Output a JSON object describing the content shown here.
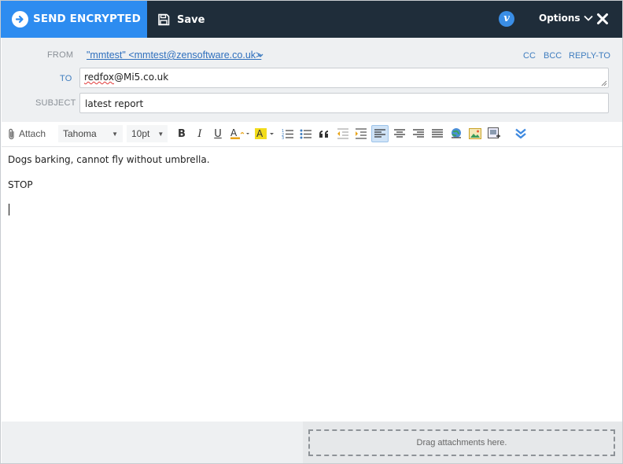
{
  "topbar": {
    "send_label": "SEND ENCRYPTED",
    "save_label": "Save",
    "brand_badge": "v",
    "options_label": "Options",
    "colors": {
      "bar_bg": "#1f2d3a",
      "send_bg": "#2d8cf0",
      "badge_bg": "#3a8ee6"
    }
  },
  "header": {
    "from_label": "FROM",
    "from_value": "\"mmtest\" <mmtest@zensoftware.co.uk>",
    "to_label": "TO",
    "to_value_name": "redfox",
    "to_value_domain": "@Mi5.co.uk",
    "subject_label": "SUBJECT",
    "subject_value": "latest report",
    "links": {
      "cc": "CC",
      "bcc": "BCC",
      "reply_to": "REPLY-TO"
    }
  },
  "toolbar": {
    "attach_label": "Attach",
    "font_value": "Tahoma",
    "size_value": "10pt",
    "bold": "B",
    "italic": "I",
    "underline": "U",
    "buttons": [
      "text-color",
      "highlight-color",
      "numbered-list",
      "bulleted-list",
      "blockquote",
      "outdent",
      "indent",
      "align-left",
      "align-center",
      "align-right",
      "justify",
      "insert-link",
      "insert-image",
      "insert-media",
      "expand-toolbar"
    ],
    "active_button": "align-left",
    "colors": {
      "text_color": "#e8a317",
      "highlight": "#f2dc1b",
      "accent": "#2d8cf0"
    }
  },
  "editor": {
    "line1": "Dogs barking, cannot fly without umbrella.",
    "line2": "STOP"
  },
  "footer": {
    "drop_text": "Drag attachments here."
  }
}
